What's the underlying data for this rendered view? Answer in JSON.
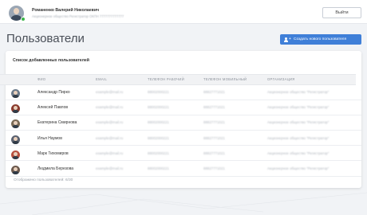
{
  "header": {
    "user_name": "Романенко Валерий Николаевич",
    "user_org": "Акционерное общество Регистратор ОКПН 7777777777777",
    "logout_label": "Выйти"
  },
  "page": {
    "title": "Пользователи",
    "create_button_label": "Создать нового пользователя"
  },
  "card": {
    "title": "Список добавленных пользователей",
    "columns": [
      "ФИО",
      "EMAIL",
      "ТЕЛЕФОН РАБОЧИЙ",
      "ТЕЛЕФОН МОБИЛЬНЫЙ",
      "ОРГАНИЗАЦИЯ"
    ],
    "rows": [
      {
        "name": "Александр Пирко",
        "email": "example@mail.ru",
        "work_phone": "88002000221",
        "mobile_phone": "88827771021",
        "org": "Акционерное общество \"Регистратор\"",
        "avatar_color": "#6b7a8a"
      },
      {
        "name": "Алексей Павлов",
        "email": "example@mail.ru",
        "work_phone": "88002000221",
        "mobile_phone": "88827771021",
        "org": "Акционерное общество \"Регистратор\"",
        "avatar_color": "#8a3b2e"
      },
      {
        "name": "Екатерина Смирнова",
        "email": "example@mail.ru",
        "work_phone": "88002000221",
        "mobile_phone": "88827771021",
        "org": "Акционерное общество \"Регистратор\"",
        "avatar_color": "#7a6a55"
      },
      {
        "name": "Илья Наумов",
        "email": "example@mail.ru",
        "work_phone": "88002000221",
        "mobile_phone": "88827771021",
        "org": "Акционерное общество \"Регистратор\"",
        "avatar_color": "#5b6270"
      },
      {
        "name": "Марк Тихомиров",
        "email": "example@mail.ru",
        "work_phone": "88002000221",
        "mobile_phone": "88827771021",
        "org": "Акционерное общество \"Регистратор\"",
        "avatar_color": "#b8503e"
      },
      {
        "name": "Людмила Березова",
        "email": "example@mail.ru",
        "work_phone": "88002000221",
        "mobile_phone": "88827771021",
        "org": "Акционерное общество \"Регистратор\"",
        "avatar_color": "#6d5a4e"
      }
    ],
    "footer": "Отображено пользователей: 6/30"
  },
  "colors": {
    "accent": "#3f7fd8",
    "online": "#3bb54a"
  }
}
